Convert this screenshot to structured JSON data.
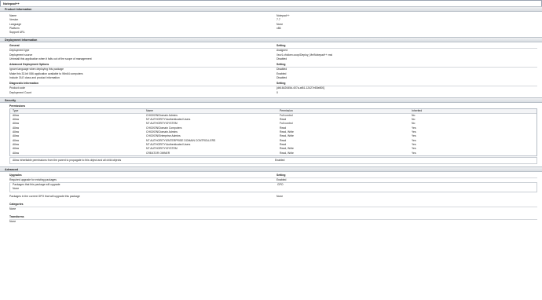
{
  "window": {
    "title": "Notepad++"
  },
  "product": {
    "header": "Product Information",
    "rows": [
      {
        "k": "Name",
        "v": "Notepad++"
      },
      {
        "k": "Version",
        "v": "7.7"
      },
      {
        "k": "Language",
        "v": "None"
      },
      {
        "k": "Platform",
        "v": "x86"
      },
      {
        "k": "Support URL",
        "v": ""
      }
    ]
  },
  "deployment": {
    "header": "Deployment Information",
    "general": {
      "title": "General",
      "setting": "Setting",
      "rows": [
        {
          "k": "Deployment type",
          "v": "Assigned"
        },
        {
          "k": "Deployment source",
          "v": "\\\\srv1.chicken.coop\\Deploy_Me\\Notepad++.msi"
        },
        {
          "k": "Uninstall this application when it falls out of the scope of management",
          "v": "Disabled"
        }
      ]
    },
    "advanced": {
      "title": "Advanced Deployment Options",
      "setting": "Setting",
      "rows": [
        {
          "k": "Ignore language when deploying this package",
          "v": "Disabled"
        },
        {
          "k": "Make this 32-bit X86 application available to Win64 computers",
          "v": "Enabled"
        },
        {
          "k": "Include OLE class and product information",
          "v": "Disabled"
        }
      ]
    },
    "diagnostic": {
      "title": "Diagnostic Information",
      "setting": "Setting",
      "rows": [
        {
          "k": "Product code",
          "v": "{db1642645d-407a-af61-12427e83e800}"
        },
        {
          "k": "Deployment Count",
          "v": "0"
        }
      ]
    }
  },
  "security": {
    "header": "Security",
    "permissions_title": "Permissions",
    "columns": [
      "Type",
      "Name",
      "Permission",
      "Inherited"
    ],
    "rows": [
      [
        "Allow",
        "CHICKEN\\Domain Admins",
        "Full control",
        "No"
      ],
      [
        "Allow",
        "NT AUTHORITY\\Authenticated Users",
        "Read",
        "No"
      ],
      [
        "Allow",
        "NT AUTHORITY\\SYSTEM",
        "Full control",
        "No"
      ],
      [
        "Allow",
        "CHICKEN\\Domain Computers",
        "Read",
        "Yes"
      ],
      [
        "Allow",
        "CHICKEN\\Domain Admins",
        "Read, Write",
        "Yes"
      ],
      [
        "Allow",
        "CHICKEN\\Enterprise Admins",
        "Read, Write",
        "Yes"
      ],
      [
        "Allow",
        "NT AUTHORITY\\ENTERPRISE DOMAIN CONTROLLERS",
        "Read",
        "Yes"
      ],
      [
        "Allow",
        "NT AUTHORITY\\Authenticated Users",
        "Read",
        "Yes"
      ],
      [
        "Allow",
        "NT AUTHORITY\\SYSTEM",
        "Read, Write",
        "Yes"
      ],
      [
        "Allow",
        "CREATOR OWNER",
        "Read, Write",
        "Yes"
      ]
    ],
    "inherit_label": "Allow inheritable permissions from the parent to propagate to this object and all child objects",
    "inherit_value": "Enabled"
  },
  "advanced_section": {
    "header": "Advanced",
    "upgrades_title": "Upgrades",
    "setting": "Setting",
    "required_upgrade_k": "Required upgrade for existing packages",
    "required_upgrade_v": "Enabled",
    "packages_will_upgrade_k": "Packages that this package will upgrade",
    "packages_will_upgrade_v": "GPO",
    "packages_will_upgrade_none": "None",
    "packages_in_gpo_k": "Packages in the current GPO that will upgrade this package",
    "packages_in_gpo_v": "None",
    "categories_title": "Categories",
    "categories_v": "None",
    "transforms_title": "Transforms",
    "transforms_v": "None"
  }
}
